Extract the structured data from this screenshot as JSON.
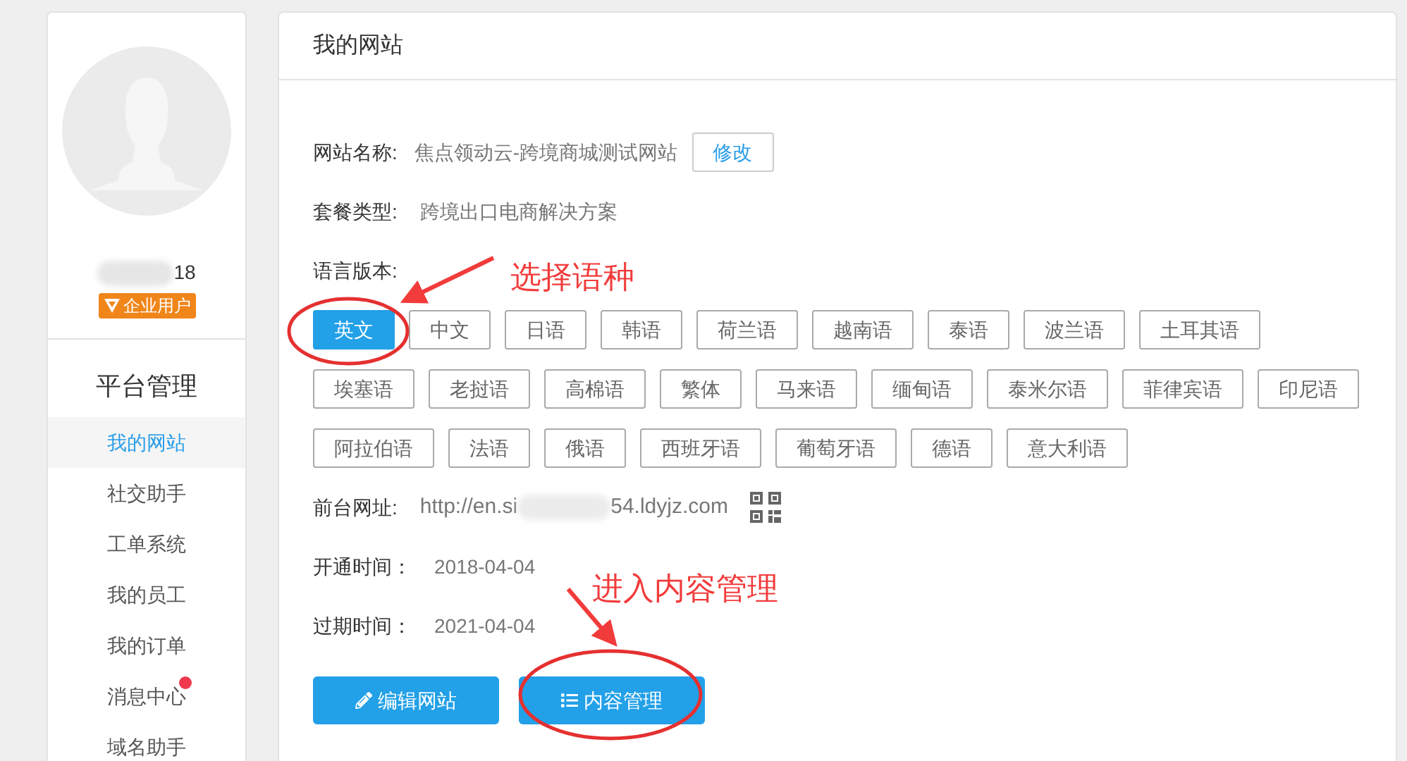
{
  "profile": {
    "username_visible": "18",
    "badge": "企业用户"
  },
  "sidebar": {
    "title": "平台管理",
    "items": [
      {
        "label": "我的网站",
        "selected": true,
        "unread": false
      },
      {
        "label": "社交助手",
        "selected": false,
        "unread": false
      },
      {
        "label": "工单系统",
        "selected": false,
        "unread": false
      },
      {
        "label": "我的员工",
        "selected": false,
        "unread": false
      },
      {
        "label": "我的订单",
        "selected": false,
        "unread": false
      },
      {
        "label": "消息中心",
        "selected": false,
        "unread": true
      },
      {
        "label": "域名助手",
        "selected": false,
        "unread": false
      }
    ]
  },
  "panel": {
    "title": "我的网站",
    "site_name": {
      "label": "网站名称:",
      "value": "焦点领动云-跨境商城测试网站",
      "button": "修改"
    },
    "package": {
      "label": "套餐类型:",
      "value": "跨境出口电商解决方案"
    },
    "languages": {
      "label": "语言版本:",
      "items": [
        {
          "label": "英文",
          "selected": true
        },
        {
          "label": "中文",
          "selected": false
        },
        {
          "label": "日语",
          "selected": false
        },
        {
          "label": "韩语",
          "selected": false
        },
        {
          "label": "荷兰语",
          "selected": false
        },
        {
          "label": "越南语",
          "selected": false
        },
        {
          "label": "泰语",
          "selected": false
        },
        {
          "label": "波兰语",
          "selected": false
        },
        {
          "label": "土耳其语",
          "selected": false
        },
        {
          "label": "埃塞语",
          "selected": false
        },
        {
          "label": "老挝语",
          "selected": false
        },
        {
          "label": "高棉语",
          "selected": false
        },
        {
          "label": "繁体",
          "selected": false
        },
        {
          "label": "马来语",
          "selected": false
        },
        {
          "label": "缅甸语",
          "selected": false
        },
        {
          "label": "泰米尔语",
          "selected": false
        },
        {
          "label": "菲律宾语",
          "selected": false
        },
        {
          "label": "印尼语",
          "selected": false
        },
        {
          "label": "阿拉伯语",
          "selected": false
        },
        {
          "label": "法语",
          "selected": false
        },
        {
          "label": "俄语",
          "selected": false
        },
        {
          "label": "西班牙语",
          "selected": false
        },
        {
          "label": "葡萄牙语",
          "selected": false
        },
        {
          "label": "德语",
          "selected": false
        },
        {
          "label": "意大利语",
          "selected": false
        }
      ]
    },
    "frontend_url": {
      "label": "前台网址:",
      "value_start": "http://en.si",
      "value_end": "54.ldyjz.com"
    },
    "opened": {
      "label": "开通时间：",
      "value": "2018-04-04"
    },
    "expires": {
      "label": "过期时间：",
      "value": "2021-04-04"
    },
    "buttons": [
      "编辑网站",
      "内容管理"
    ]
  },
  "annotations": [
    "选择语种",
    "进入内容管理"
  ]
}
